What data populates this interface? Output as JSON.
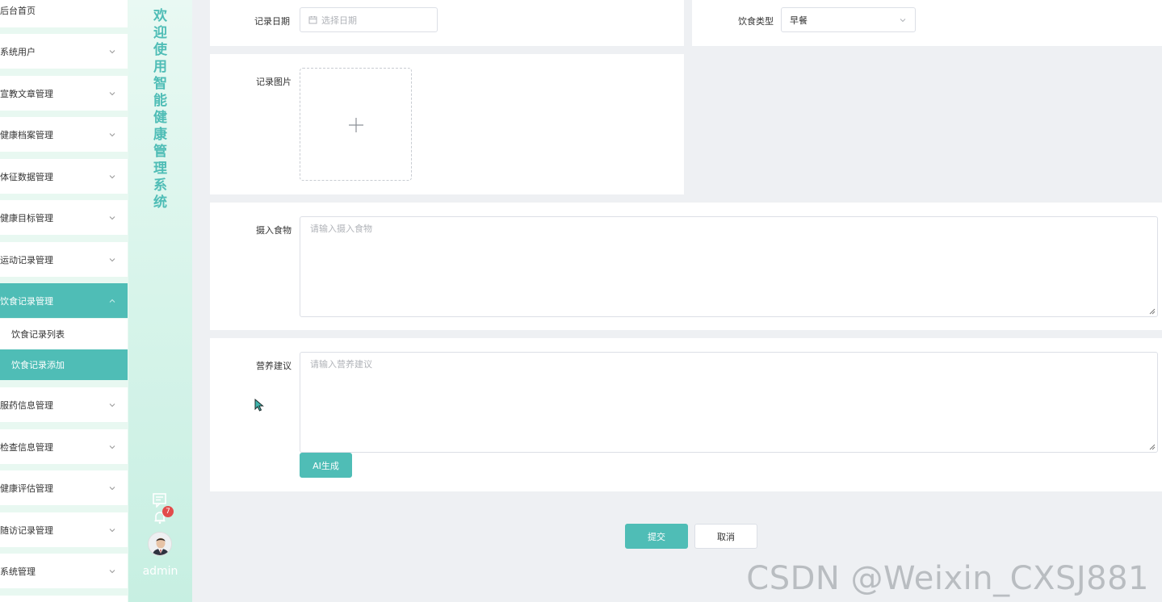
{
  "sidebar": {
    "items": [
      {
        "label": "后台首页",
        "has_chevron": false,
        "active": false
      },
      {
        "label": "系统用户",
        "has_chevron": true,
        "active": false
      },
      {
        "label": "宣教文章管理",
        "has_chevron": true,
        "active": false
      },
      {
        "label": "健康档案管理",
        "has_chevron": true,
        "active": false
      },
      {
        "label": "体征数据管理",
        "has_chevron": true,
        "active": false
      },
      {
        "label": "健康目标管理",
        "has_chevron": true,
        "active": false
      },
      {
        "label": "运动记录管理",
        "has_chevron": true,
        "active": false
      },
      {
        "label": "饮食记录管理",
        "has_chevron": true,
        "active": true
      },
      {
        "label": "服药信息管理",
        "has_chevron": true,
        "active": false
      },
      {
        "label": "检查信息管理",
        "has_chevron": true,
        "active": false
      },
      {
        "label": "健康评估管理",
        "has_chevron": true,
        "active": false
      },
      {
        "label": "随访记录管理",
        "has_chevron": true,
        "active": false
      },
      {
        "label": "系统管理",
        "has_chevron": true,
        "active": false
      }
    ],
    "submenu": [
      {
        "label": "饮食记录列表",
        "active": false
      },
      {
        "label": "饮食记录添加",
        "active": true
      }
    ]
  },
  "welcome": {
    "title_chars": [
      "欢",
      "迎",
      "使",
      "用",
      "智",
      "能",
      "健",
      "康",
      "管",
      "理",
      "系",
      "统"
    ],
    "notification_count": "7",
    "username": "admin"
  },
  "form": {
    "record_date_label": "记录日期",
    "record_date_placeholder": "选择日期",
    "diet_type_label": "饮食类型",
    "diet_type_value": "早餐",
    "record_image_label": "记录图片",
    "food_intake_label": "摄入食物",
    "food_intake_placeholder": "请输入摄入食物",
    "nutrition_advice_label": "营养建议",
    "nutrition_advice_placeholder": "请输入营养建议",
    "ai_generate_label": "AI生成",
    "submit_label": "提交",
    "cancel_label": "取消"
  },
  "watermark": "CSDN @Weixin_CXSJ881",
  "colors": {
    "accent": "#4fbdb6",
    "badge": "#e24c4c",
    "sidebar_bg": "#e8f8f1",
    "page_bg": "#eef0f3"
  }
}
